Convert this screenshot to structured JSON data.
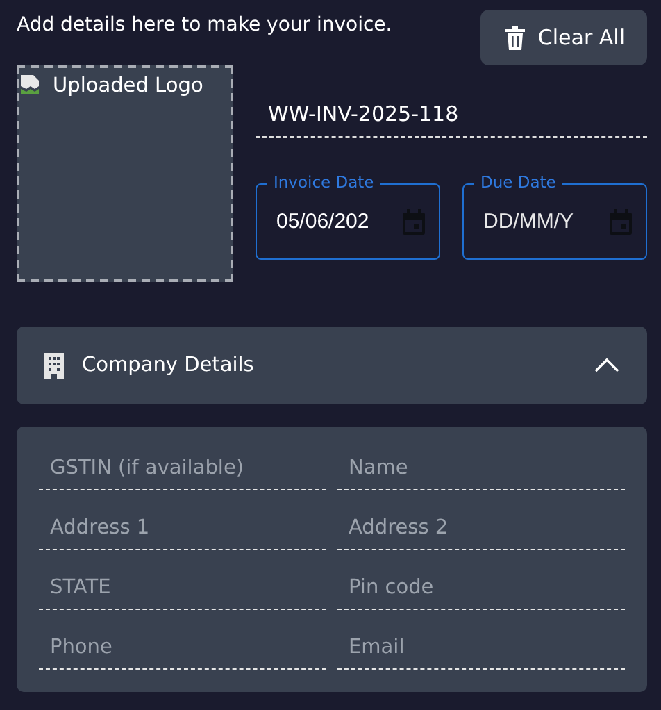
{
  "intro": "Add details here to make your invoice.",
  "clear_button": {
    "label": "Clear All"
  },
  "logo": {
    "alt": "Uploaded Logo"
  },
  "invoice_number": {
    "value": "WW-INV-2025-118"
  },
  "dates": [
    {
      "label": "Invoice Date",
      "value": "05/06/202",
      "kind": "value"
    },
    {
      "label": "Due Date",
      "placeholder": "DD/MM/Y",
      "kind": "placeholder"
    }
  ],
  "company_section": {
    "title": "Company Details",
    "expanded": true,
    "fields": [
      {
        "placeholder": "GSTIN (if available)"
      },
      {
        "placeholder": "Name"
      },
      {
        "placeholder": "Address 1"
      },
      {
        "placeholder": "Address 2"
      },
      {
        "placeholder": "STATE"
      },
      {
        "placeholder": "Pin code"
      },
      {
        "placeholder": "Phone"
      },
      {
        "placeholder": "Email"
      }
    ]
  }
}
